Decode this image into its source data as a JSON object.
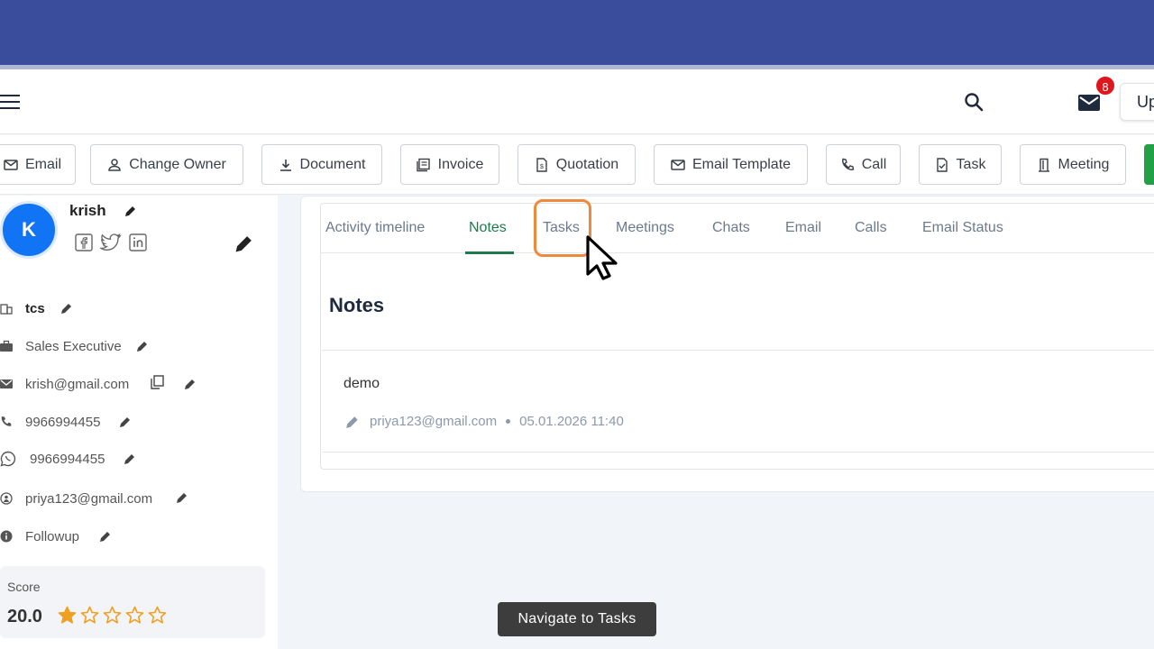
{
  "header": {
    "notification_count": "8",
    "upgrade_label": "Up"
  },
  "actions": [
    {
      "label": "Email",
      "icon": "mail-icon"
    },
    {
      "label": "Change Owner",
      "icon": "person-icon"
    },
    {
      "label": "Document",
      "icon": "download-icon"
    },
    {
      "label": "Invoice",
      "icon": "invoice-icon"
    },
    {
      "label": "Quotation",
      "icon": "quotation-icon"
    },
    {
      "label": "Email Template",
      "icon": "mail-icon"
    },
    {
      "label": "Call",
      "icon": "phone-icon"
    },
    {
      "label": "Task",
      "icon": "task-icon"
    },
    {
      "label": "Meeting",
      "icon": "door-icon"
    }
  ],
  "profile": {
    "avatar_letter": "K",
    "name": "krish",
    "company": "tcs",
    "title": "Sales Executive",
    "email": "krish@gmail.com",
    "phone": "9966994455",
    "whatsapp": "9966994455",
    "owner": "priya123@gmail.com",
    "status": "Followup",
    "score_label": "Score",
    "score_value": "20.0",
    "rating": 1
  },
  "tabs": [
    {
      "label": "Activity timeline"
    },
    {
      "label": "Notes"
    },
    {
      "label": "Tasks"
    },
    {
      "label": "Meetings"
    },
    {
      "label": "Chats"
    },
    {
      "label": "Email"
    },
    {
      "label": "Calls"
    },
    {
      "label": "Email Status"
    }
  ],
  "active_tab": "Notes",
  "notes": {
    "heading": "Notes",
    "items": [
      {
        "text": "demo",
        "author": "priya123@gmail.com",
        "timestamp": "05.01.2026 11:40"
      }
    ]
  },
  "tooltip": "Navigate to Tasks",
  "colors": {
    "banner": "#394d9c",
    "accent_green": "#1e7a4a",
    "avatar_blue": "#1174f5",
    "highlight_orange": "#ef8a3c",
    "badge_red": "#e0161e",
    "star_gold": "#f0a020"
  }
}
